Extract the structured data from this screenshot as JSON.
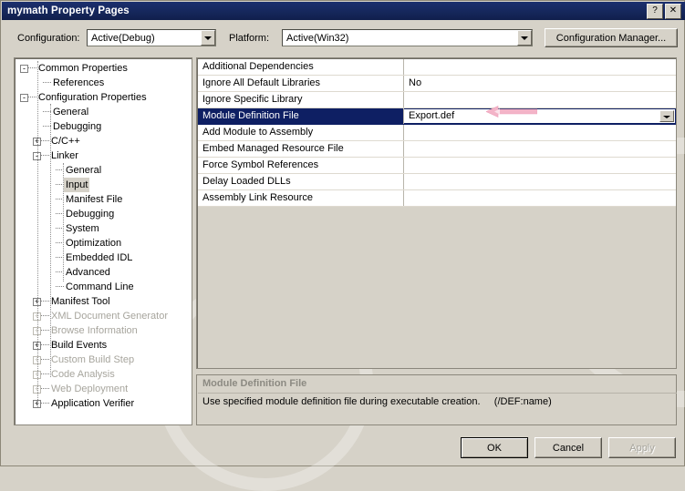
{
  "window": {
    "title": "mymath Property Pages",
    "help_button": "?",
    "close_button": "✕"
  },
  "config_bar": {
    "configuration_label": "Configuration:",
    "configuration_value": "Active(Debug)",
    "platform_label": "Platform:",
    "platform_value": "Active(Win32)",
    "configuration_manager_label": "Configuration Manager..."
  },
  "tree": {
    "items": [
      {
        "label": "Common Properties",
        "level": 0,
        "expander": "-",
        "disabled": false,
        "selected": false
      },
      {
        "label": "References",
        "level": 1,
        "expander": "",
        "disabled": false,
        "selected": false
      },
      {
        "label": "Configuration Properties",
        "level": 0,
        "expander": "-",
        "disabled": false,
        "selected": false
      },
      {
        "label": "General",
        "level": 1,
        "expander": "",
        "disabled": false,
        "selected": false
      },
      {
        "label": "Debugging",
        "level": 1,
        "expander": "",
        "disabled": false,
        "selected": false
      },
      {
        "label": "C/C++",
        "level": 1,
        "expander": "+",
        "disabled": false,
        "selected": false
      },
      {
        "label": "Linker",
        "level": 1,
        "expander": "-",
        "disabled": false,
        "selected": false
      },
      {
        "label": "General",
        "level": 2,
        "expander": "",
        "disabled": false,
        "selected": false
      },
      {
        "label": "Input",
        "level": 2,
        "expander": "",
        "disabled": false,
        "selected": true
      },
      {
        "label": "Manifest File",
        "level": 2,
        "expander": "",
        "disabled": false,
        "selected": false
      },
      {
        "label": "Debugging",
        "level": 2,
        "expander": "",
        "disabled": false,
        "selected": false
      },
      {
        "label": "System",
        "level": 2,
        "expander": "",
        "disabled": false,
        "selected": false
      },
      {
        "label": "Optimization",
        "level": 2,
        "expander": "",
        "disabled": false,
        "selected": false
      },
      {
        "label": "Embedded IDL",
        "level": 2,
        "expander": "",
        "disabled": false,
        "selected": false
      },
      {
        "label": "Advanced",
        "level": 2,
        "expander": "",
        "disabled": false,
        "selected": false
      },
      {
        "label": "Command Line",
        "level": 2,
        "expander": "",
        "disabled": false,
        "selected": false
      },
      {
        "label": "Manifest Tool",
        "level": 1,
        "expander": "+",
        "disabled": false,
        "selected": false
      },
      {
        "label": "XML Document Generator",
        "level": 1,
        "expander": "+",
        "disabled": true,
        "selected": false
      },
      {
        "label": "Browse Information",
        "level": 1,
        "expander": "+",
        "disabled": true,
        "selected": false
      },
      {
        "label": "Build Events",
        "level": 1,
        "expander": "+",
        "disabled": false,
        "selected": false
      },
      {
        "label": "Custom Build Step",
        "level": 1,
        "expander": "+",
        "disabled": true,
        "selected": false
      },
      {
        "label": "Code Analysis",
        "level": 1,
        "expander": "+",
        "disabled": true,
        "selected": false
      },
      {
        "label": "Web Deployment",
        "level": 1,
        "expander": "+",
        "disabled": true,
        "selected": false
      },
      {
        "label": "Application Verifier",
        "level": 1,
        "expander": "+",
        "disabled": false,
        "selected": false
      }
    ]
  },
  "property_grid": {
    "rows": [
      {
        "name": "Additional Dependencies",
        "value": "",
        "selected": false
      },
      {
        "name": "Ignore All Default Libraries",
        "value": "No",
        "selected": false
      },
      {
        "name": "Ignore Specific Library",
        "value": "",
        "selected": false
      },
      {
        "name": "Module Definition File",
        "value": "Export.def",
        "selected": true
      },
      {
        "name": "Add Module to Assembly",
        "value": "",
        "selected": false
      },
      {
        "name": "Embed Managed Resource File",
        "value": "",
        "selected": false
      },
      {
        "name": "Force Symbol References",
        "value": "",
        "selected": false
      },
      {
        "name": "Delay Loaded DLLs",
        "value": "",
        "selected": false
      },
      {
        "name": "Assembly Link Resource",
        "value": "",
        "selected": false
      }
    ]
  },
  "description": {
    "title": "Module Definition File",
    "body": "Use specified module definition file during executable creation.     (/DEF:name)"
  },
  "buttons": {
    "ok": "OK",
    "cancel": "Cancel",
    "apply": "Apply"
  },
  "annotation": {
    "arrow_color": "#f3b4c8",
    "direction": "left"
  },
  "colors": {
    "titlebar": "#17295f",
    "selection": "#0e1f63",
    "dialog_face": "#d6d2c8",
    "disabled_text": "#a7a59d"
  }
}
